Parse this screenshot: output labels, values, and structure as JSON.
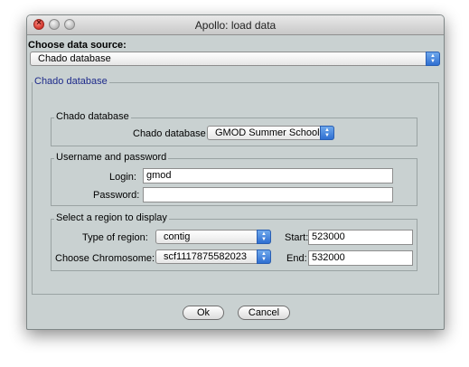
{
  "window": {
    "title": "Apollo: load data"
  },
  "source": {
    "label": "Choose data source:",
    "selected": "Chado database"
  },
  "panel": {
    "title": "Chado database",
    "db_group": {
      "title": "Chado database",
      "field_label": "Chado database",
      "selected": "GMOD Summer School"
    },
    "auth_group": {
      "title": "Username and password",
      "login_label": "Login:",
      "login_value": "gmod",
      "password_label": "Password:",
      "password_value": ""
    },
    "region_group": {
      "title": "Select a region to display",
      "type_label": "Type of region:",
      "type_selected": "contig",
      "chrom_label": "Choose Chromosome:",
      "chrom_selected": "scf1117875582023",
      "start_label": "Start:",
      "start_value": "523000",
      "end_label": "End:",
      "end_value": "532000"
    }
  },
  "buttons": {
    "ok": "Ok",
    "cancel": "Cancel"
  }
}
